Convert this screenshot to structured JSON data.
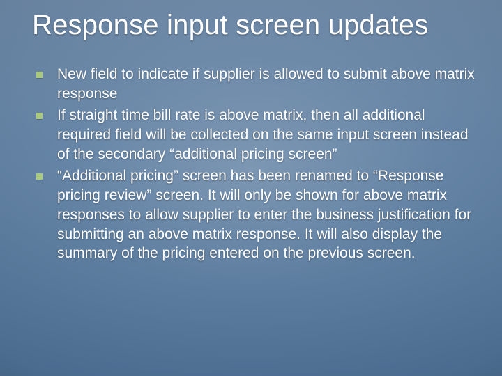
{
  "title": "Response input screen updates",
  "bullets": {
    "items": [
      {
        "text": "New field to indicate if supplier is allowed to submit above matrix response"
      },
      {
        "text": "If straight time bill rate is above matrix, then all additional required field will be collected on the same input screen instead of the secondary “additional pricing screen”"
      },
      {
        "text": "“Additional pricing” screen has been renamed to “Response pricing review” screen. It will only be shown for above matrix responses to allow supplier to enter the business justification for submitting an above matrix response. It will also display the summary of the pricing entered on the previous screen."
      }
    ]
  },
  "colors": {
    "bullet_marker": "#a9c97f",
    "text": "#ffffff",
    "bg_top": "#6b87a6",
    "bg_bottom": "#4e7196"
  }
}
